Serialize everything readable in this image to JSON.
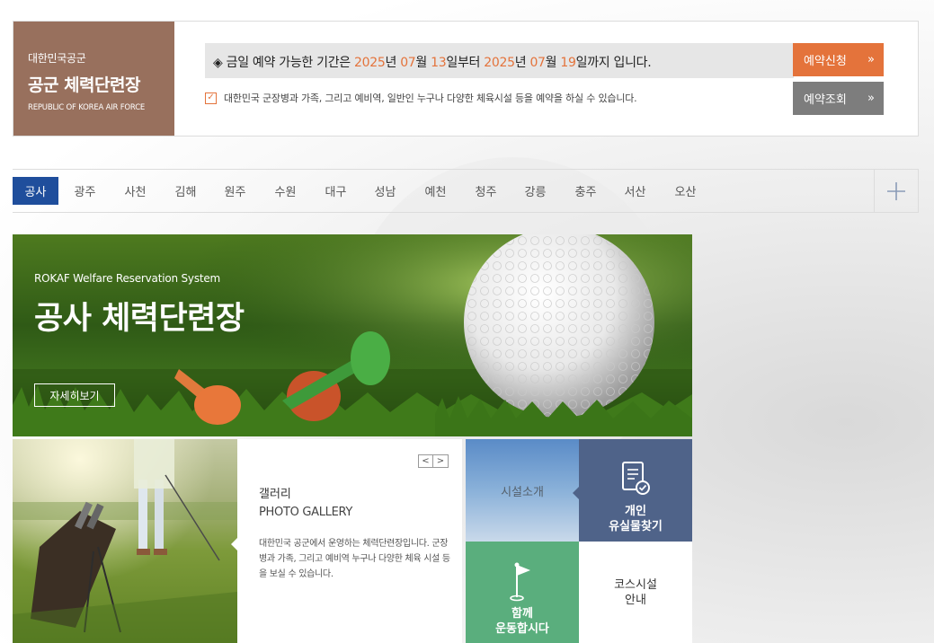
{
  "header": {
    "brand_sub": "대한민국공군",
    "brand_name": "공군 체력단련장",
    "brand_eng": "REPUBLIC OF KOREA AIR FORCE",
    "notice": {
      "prefix": "◈ 금일 예약 가능한 기간은 ",
      "start_year": "2025",
      "year_label": "년 ",
      "start_month": "07",
      "month_label": "월 ",
      "start_day": "13",
      "start_suffix": "일부터 ",
      "end_year": "2025",
      "end_month": "07",
      "end_day": "19",
      "end_suffix": "일까지 입니다."
    },
    "info_text": "대한민국 군장병과 가족, 그리고 예비역, 일반인 누구나 다양한 체육시설 등을 예약을 하실 수 있습니다.",
    "btn_apply": "예약신청",
    "btn_check": "예약조회",
    "arrow_glyph": "»"
  },
  "tabs": {
    "items": [
      "공사",
      "광주",
      "사천",
      "김해",
      "원주",
      "수원",
      "대구",
      "성남",
      "예천",
      "청주",
      "강릉",
      "충주",
      "서산",
      "오산"
    ],
    "active_index": 0
  },
  "hero": {
    "subtitle": "ROKAF Welfare Reservation System",
    "title": "공사 체력단련장",
    "button": "자세히보기"
  },
  "gallery": {
    "title": "갤러리",
    "title_en": "PHOTO GALLERY",
    "description": "대한민국 공군에서 운영하는 체력단련장입니다. 군장병과 가족, 그리고 예비역 누구나 다양한 체육 시설 등을 보실 수 있습니다.",
    "prev": "<",
    "next": ">"
  },
  "quick_menu": {
    "facility": "시설소개",
    "lost_line1": "개인",
    "lost_line2": "유실물찾기",
    "together_line1": "함께",
    "together_line2": "운동합시다",
    "course_line1": "코스시설",
    "course_line2": "안내"
  },
  "colors": {
    "brand": "#98705d",
    "accent_orange": "#e4733b",
    "tab_active": "#1f4e9c",
    "lost_bg": "#4f6389",
    "together_bg": "#5aae7d"
  }
}
